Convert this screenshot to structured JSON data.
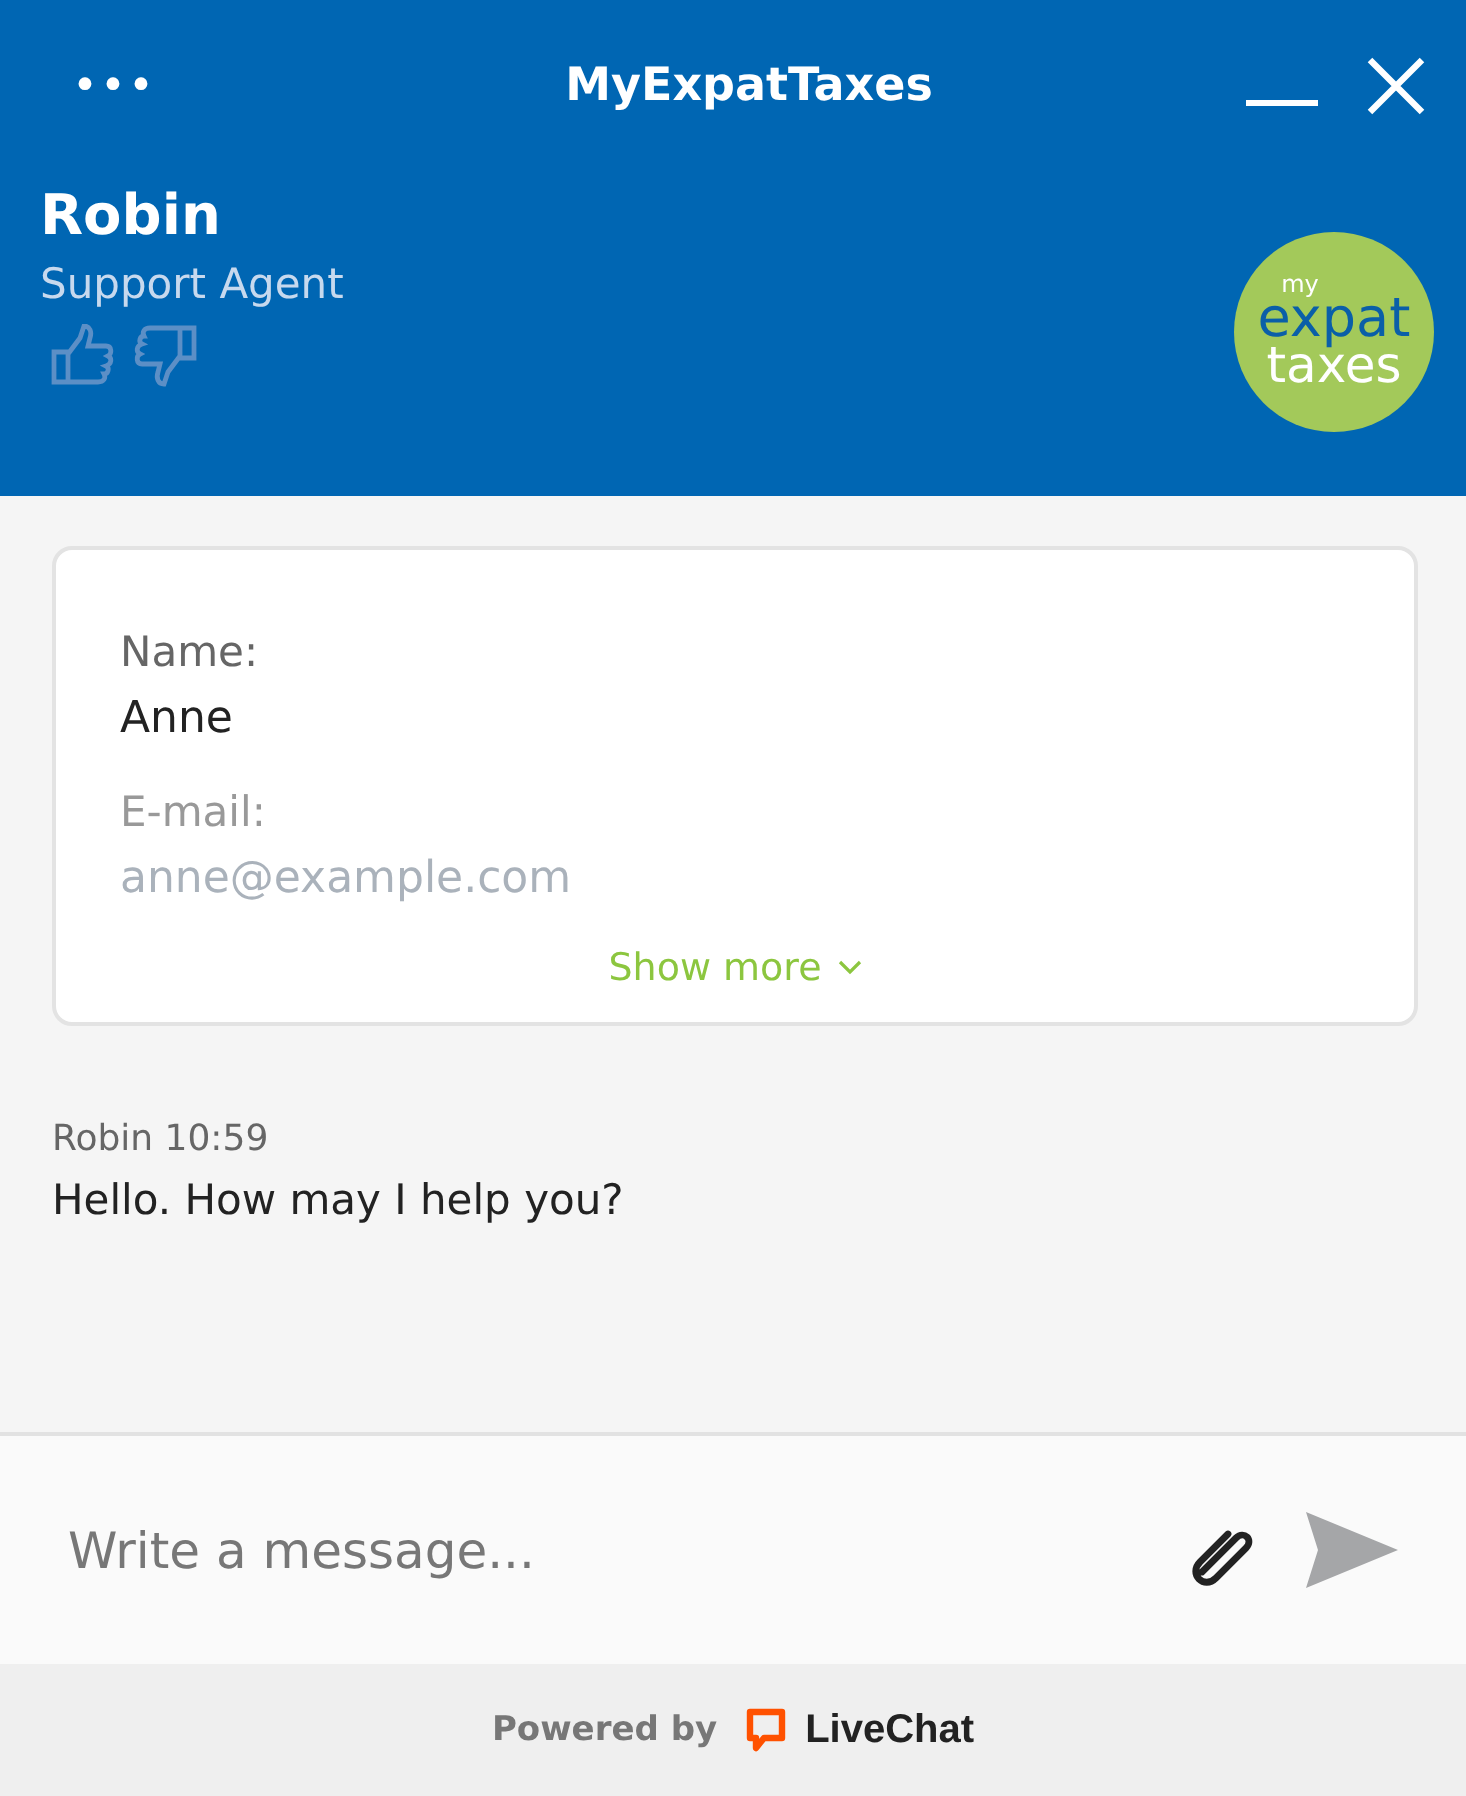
{
  "window": {
    "title": "MyExpatTaxes",
    "menu_icon": "•••"
  },
  "agent": {
    "name": "Robin",
    "role": "Support Agent",
    "logo": [
      "my",
      "expat",
      "taxes"
    ]
  },
  "form_card": {
    "fields": [
      {
        "label": "Name:",
        "value": "Anne",
        "kind": "plain"
      },
      {
        "label": "E-mail:",
        "value": "anne@example.com",
        "kind": "faded"
      }
    ],
    "show_more": "Show more"
  },
  "messages": [
    {
      "author": "Robin",
      "time": "10:59",
      "text": "Hello. How may I help you?"
    }
  ],
  "composer": {
    "placeholder": "Write a message...",
    "send_disabled": true
  },
  "footer": {
    "prefix": "Powered by",
    "brand": "LiveChat"
  }
}
